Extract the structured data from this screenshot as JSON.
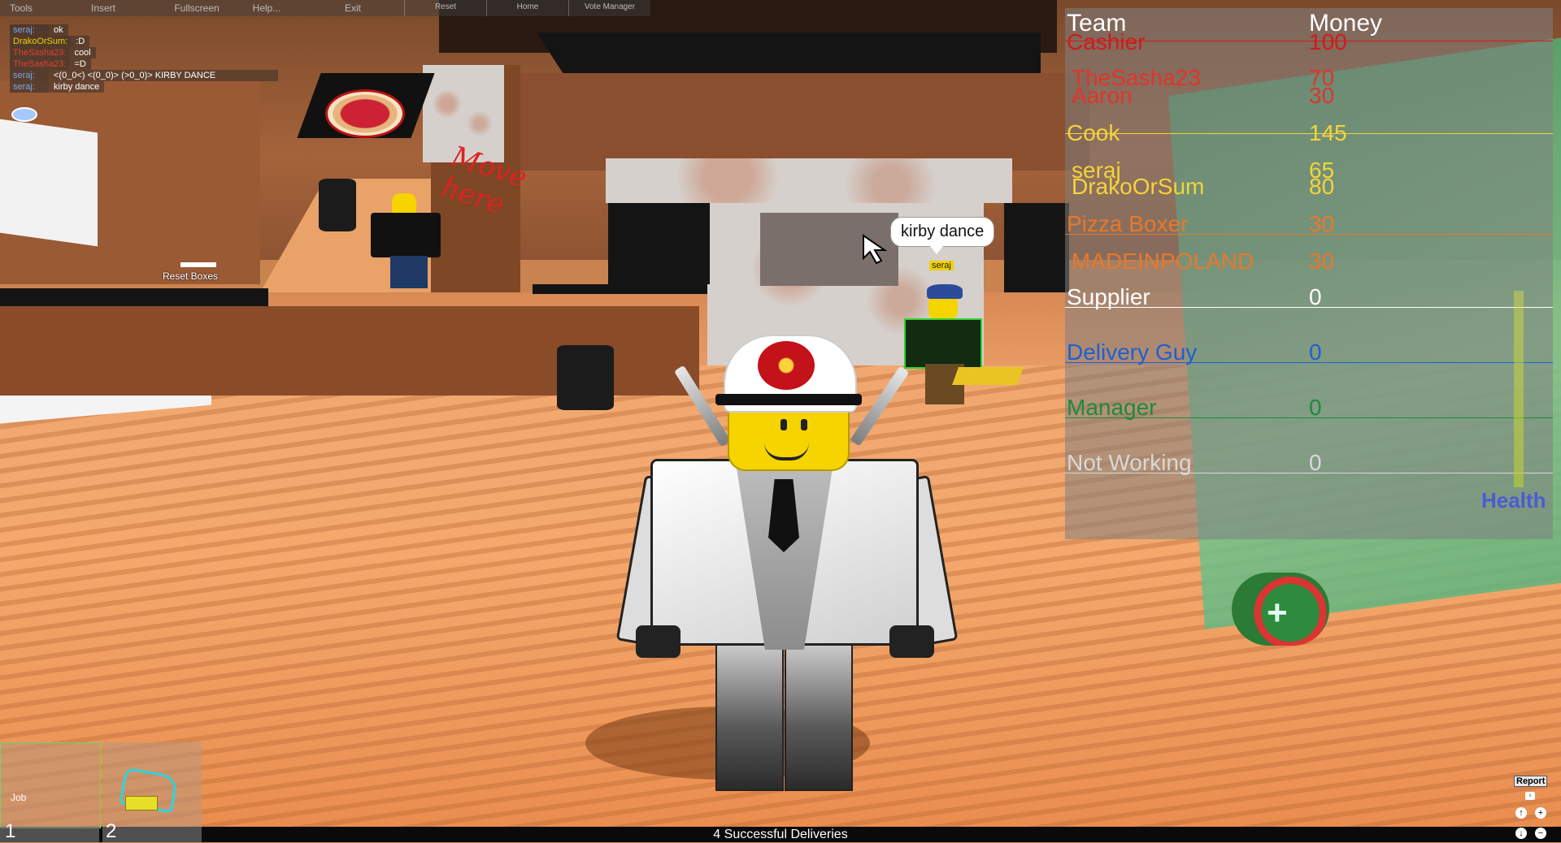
{
  "menu": {
    "left_items": [
      "Tools",
      "Insert",
      "Fullscreen",
      "Help...",
      "Exit"
    ],
    "right_items": [
      "Reset",
      "Home",
      "Vote Manager"
    ]
  },
  "chat": [
    {
      "who": "seraj:",
      "who_color": "#7aa7e8",
      "msg": "ok"
    },
    {
      "who": "DrakoOrSum:",
      "who_color": "#f0d000",
      "msg": ":D"
    },
    {
      "who": "TheSasha23:",
      "who_color": "#e2412f",
      "msg": "cool"
    },
    {
      "who": "TheSasha23:",
      "who_color": "#e2412f",
      "msg": "=D"
    },
    {
      "who": "seraj:",
      "who_color": "#7aa7e8",
      "msg": "<(0_0<) <(0_0)> (>0_0)> KIRBY DANCE"
    },
    {
      "who": "seraj:",
      "who_color": "#7aa7e8",
      "msg": "kirby dance"
    }
  ],
  "scene": {
    "reset_boxes_label": "Reset Boxes",
    "scribble": "Move\nhere",
    "bubble_text": "kirby dance",
    "nametag": "seraj"
  },
  "leaderboard": {
    "header_team": "Team",
    "header_money": "Money",
    "rows": [
      {
        "name": "Cashier",
        "money": "100",
        "color": "#d21a1a",
        "kind": "team"
      },
      {
        "name": "TheSasha23",
        "money": "70",
        "color": "#e0342a",
        "kind": "player"
      },
      {
        "name": "Aaron",
        "money": "30",
        "color": "#e0342a",
        "kind": "player"
      },
      {
        "name": "Cook",
        "money": "145",
        "color": "#f3d43a",
        "kind": "team"
      },
      {
        "name": "seraj",
        "money": "65",
        "color": "#f3d43a",
        "kind": "player"
      },
      {
        "name": "DrakoOrSum",
        "money": "80",
        "color": "#f3d43a",
        "kind": "player"
      },
      {
        "name": "Pizza Boxer",
        "money": "30",
        "color": "#e7792a",
        "kind": "team"
      },
      {
        "name": "MADEINPOLAND",
        "money": "30",
        "color": "#e7792a",
        "kind": "player"
      },
      {
        "name": "Supplier",
        "money": "0",
        "color": "#ffffff",
        "kind": "team"
      },
      {
        "name": "Delivery Guy",
        "money": "0",
        "color": "#1f5fd0",
        "kind": "team"
      },
      {
        "name": "Manager",
        "money": "0",
        "color": "#1f8a3a",
        "kind": "team"
      },
      {
        "name": "Not Working",
        "money": "0",
        "color": "#d8d8d8",
        "kind": "team"
      }
    ],
    "health_label": "Health"
  },
  "toolbar": {
    "slots": [
      {
        "num": "1",
        "label": "Job"
      },
      {
        "num": "2",
        "label": ""
      }
    ]
  },
  "status": {
    "deliveries": "4 Successful Deliveries",
    "report_label": "Report"
  }
}
